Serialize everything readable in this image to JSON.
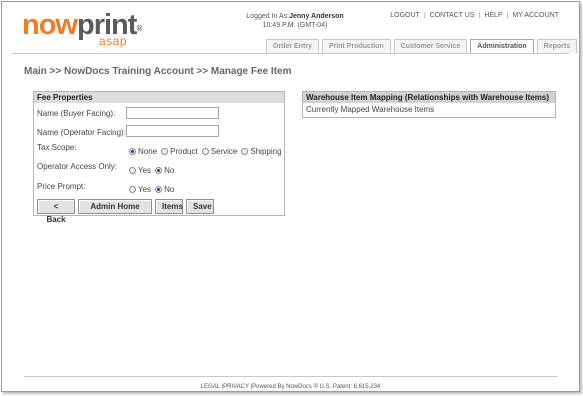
{
  "logo": {
    "now": "now",
    "print": "print",
    "tm": "®",
    "sub": "asap"
  },
  "user": {
    "logged_in_prefix": "Logged In As:",
    "name": "Jenny Anderson",
    "time": "10:49 P.M. (GMT-04)"
  },
  "toplinks": [
    "LOGOUT",
    "CONTACT US",
    "HELP",
    "MY ACCOUNT"
  ],
  "tabs": [
    "Order Entry",
    "Print Production",
    "Customer Service",
    "Administration",
    "Reports"
  ],
  "active_tab": "Administration",
  "breadcrumb": "Main >> NowDocs Training Account >> Manage Fee Item",
  "fee_panel": {
    "title": "Fee Properties",
    "buyer_label": "Name (Buyer Facing):",
    "buyer_value": "",
    "operator_label": "Name (Operator Facing):",
    "operator_value": "",
    "tax_label": "Tax Scope:",
    "tax_options": [
      "None",
      "Product",
      "Service",
      "Shipping"
    ],
    "tax_selected": "None",
    "op_access_label": "Operator Access Only:",
    "op_access_options": [
      "Yes",
      "No"
    ],
    "op_access_selected": "No",
    "price_prompt_label": "Price Prompt:",
    "price_prompt_options": [
      "Yes",
      "No"
    ],
    "price_prompt_selected": "No",
    "buttons": {
      "back": "< Back",
      "admin_home": "Admin Home",
      "items": "Items",
      "save": "Save"
    }
  },
  "warehouse_panel": {
    "title": "Warehouse Item Mapping (Relationships with Warehouse Items)",
    "body": "Currently Mapped Warehouse Items"
  },
  "footer": {
    "legal": "LEGAL",
    "privacy": "PRIVACY",
    "powered": "Powered By NowDocs ® U.S. Patent: 6,615,234"
  },
  "colors": {
    "brand_orange": "#f47b20",
    "panel_header": "#dcdcdc",
    "radio_fill": "#1a3d8f"
  }
}
